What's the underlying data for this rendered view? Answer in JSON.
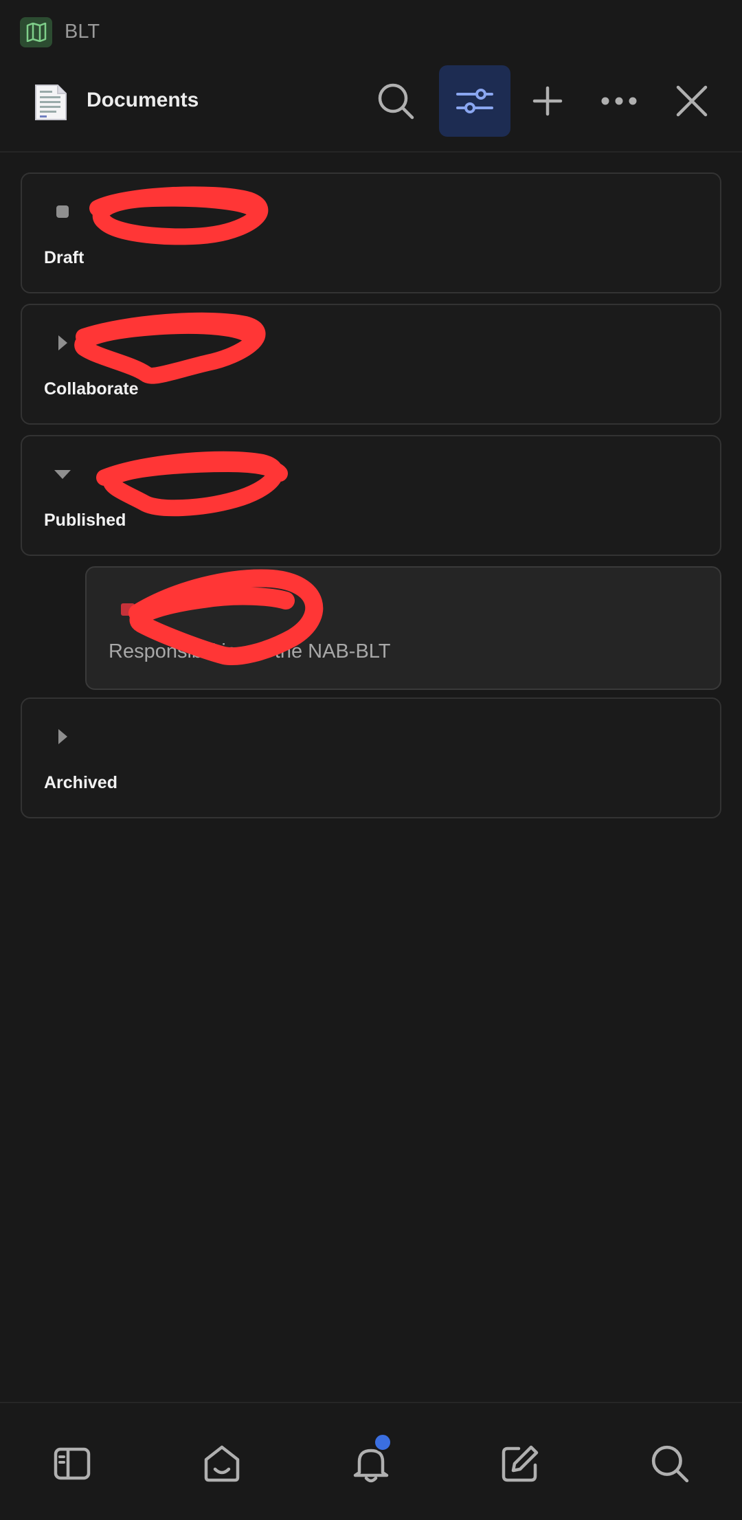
{
  "workspace": {
    "name": "BLT",
    "logo_icon": "map-icon",
    "logo_color": "#2c4c31"
  },
  "header": {
    "title": "Documents",
    "doc_icon": "document-icon",
    "buttons": [
      "search-icon",
      "filter-sliders-icon",
      "plus-icon",
      "more-icon",
      "close-icon"
    ],
    "active_color": "#1d2c52"
  },
  "groups": [
    {
      "label": "Draft",
      "toggle": "square-icon"
    },
    {
      "label": "Collaborate",
      "toggle": "chevron-right-icon"
    },
    {
      "label": "Published",
      "toggle": "chevron-down-icon"
    },
    {
      "label": "Archived",
      "toggle": "chevron-right-icon"
    }
  ],
  "published_doc": {
    "title": "Responsibilities of the NAB-BLT"
  },
  "bottom_nav": {
    "items": [
      "sidebar-icon",
      "home-icon",
      "bell-icon",
      "edit-icon",
      "search-icon"
    ],
    "badge_color": "#3b6fe0"
  },
  "redaction_color": "#ff3636"
}
